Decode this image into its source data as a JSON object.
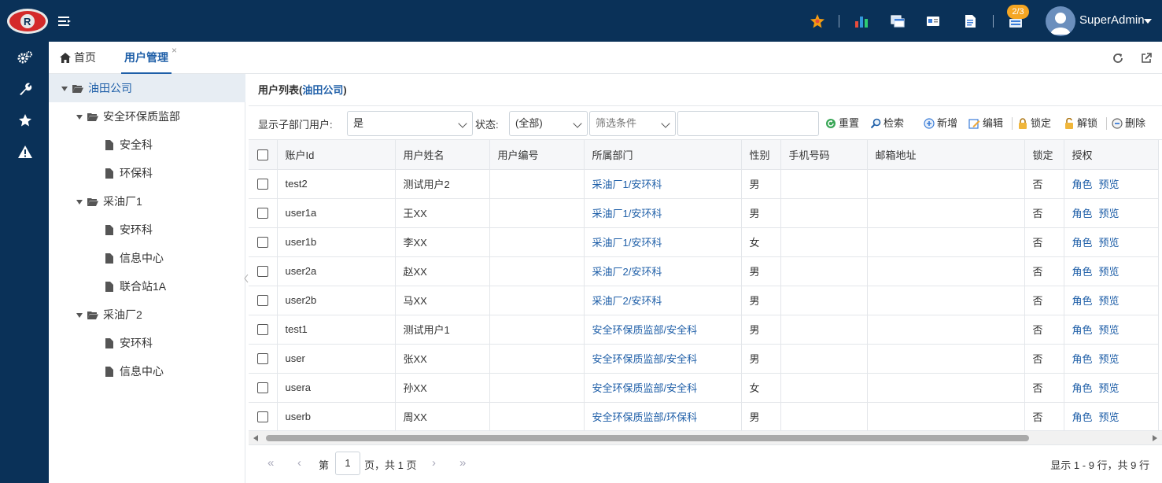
{
  "header": {
    "badge": "2/3",
    "username": "SuperAdmin"
  },
  "tabs": {
    "home_label": "首页",
    "user_label": "用户管理",
    "close_symbol": "×"
  },
  "tree": {
    "root": "油田公司",
    "n1": "安全环保质监部",
    "n1_c1": "安全科",
    "n1_c2": "环保科",
    "n2": "采油厂1",
    "n2_c1": "安环科",
    "n2_c2": "信息中心",
    "n2_c3": "联合站1A",
    "n3": "采油厂2",
    "n3_c1": "安环科",
    "n3_c2": "信息中心"
  },
  "panel": {
    "title_prefix": "用户列表(",
    "title_org": "油田公司",
    "title_suffix": ")"
  },
  "toolbar": {
    "show_sub_label": "显示子部门用户:",
    "show_sub_value": "是",
    "status_label": "状态:",
    "status_value": "(全部)",
    "filter_placeholder": "筛选条件",
    "reset": "重置",
    "search": "检索",
    "add": "新增",
    "edit": "编辑",
    "lock": "锁定",
    "unlock": "解锁",
    "delete": "删除"
  },
  "table": {
    "columns": [
      "账户Id",
      "用户姓名",
      "用户编号",
      "所属部门",
      "性别",
      "手机号码",
      "邮箱地址",
      "锁定",
      "授权"
    ],
    "auth_role": "角色",
    "auth_preview": "预览",
    "rows": [
      {
        "id": "test2",
        "name": "测试用户2",
        "code": "",
        "dept": "采油厂1/安环科",
        "gender": "男",
        "phone": "",
        "email": "",
        "locked": "否"
      },
      {
        "id": "user1a",
        "name": "王XX",
        "code": "",
        "dept": "采油厂1/安环科",
        "gender": "男",
        "phone": "",
        "email": "",
        "locked": "否"
      },
      {
        "id": "user1b",
        "name": "李XX",
        "code": "",
        "dept": "采油厂1/安环科",
        "gender": "女",
        "phone": "",
        "email": "",
        "locked": "否"
      },
      {
        "id": "user2a",
        "name": "赵XX",
        "code": "",
        "dept": "采油厂2/安环科",
        "gender": "男",
        "phone": "",
        "email": "",
        "locked": "否"
      },
      {
        "id": "user2b",
        "name": "马XX",
        "code": "",
        "dept": "采油厂2/安环科",
        "gender": "男",
        "phone": "",
        "email": "",
        "locked": "否"
      },
      {
        "id": "test1",
        "name": "测试用户1",
        "code": "",
        "dept": "安全环保质监部/安全科",
        "gender": "男",
        "phone": "",
        "email": "",
        "locked": "否"
      },
      {
        "id": "user",
        "name": "张XX",
        "code": "",
        "dept": "安全环保质监部/安全科",
        "gender": "男",
        "phone": "",
        "email": "",
        "locked": "否"
      },
      {
        "id": "usera",
        "name": "孙XX",
        "code": "",
        "dept": "安全环保质监部/安全科",
        "gender": "女",
        "phone": "",
        "email": "",
        "locked": "否"
      },
      {
        "id": "userb",
        "name": "周XX",
        "code": "",
        "dept": "安全环保质监部/环保科",
        "gender": "男",
        "phone": "",
        "email": "",
        "locked": "否"
      }
    ]
  },
  "pager": {
    "first": "«",
    "prev": "‹",
    "page_prefix": "第",
    "page_value": "1",
    "page_suffix": "页，共 1 页",
    "next": "›",
    "last": "»",
    "info": "显示 1 - 9 行，共 9 行"
  }
}
